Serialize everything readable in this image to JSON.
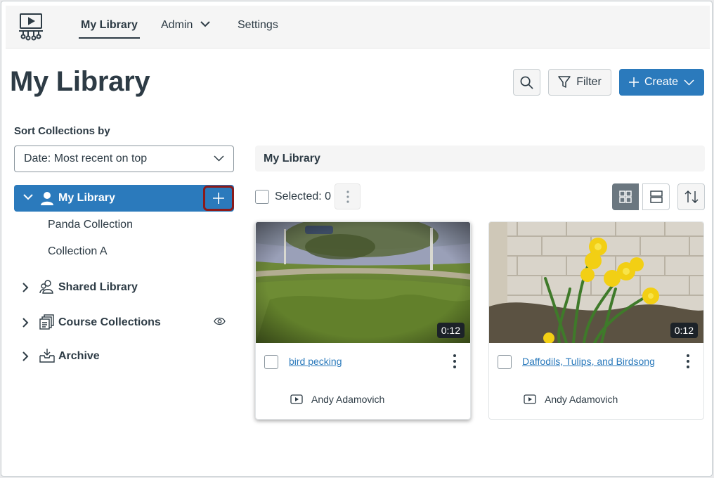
{
  "nav": {
    "items": [
      {
        "label": "My Library"
      },
      {
        "label": "Admin"
      },
      {
        "label": "Settings"
      }
    ]
  },
  "page": {
    "title": "My Library"
  },
  "toolbar": {
    "filter_label": "Filter",
    "create_label": "Create"
  },
  "sidebar": {
    "sort_label": "Sort Collections by",
    "sort_value": "Date: Most recent on top",
    "tree": {
      "my_library": "My Library",
      "sub_collections": [
        "Panda Collection",
        "Collection A"
      ],
      "shared_library": "Shared Library",
      "course_collections": "Course Collections",
      "archive": "Archive"
    }
  },
  "content": {
    "breadcrumb": "My Library",
    "selected_label": "Selected: 0",
    "cards": [
      {
        "title": "bird pecking",
        "duration": "0:12",
        "owner": "Andy Adamovich"
      },
      {
        "title": "Daffodils, Tulips, and Birdsong",
        "duration": "0:12",
        "owner": "Andy Adamovich"
      }
    ]
  },
  "colors": {
    "accent": "#2b7abc",
    "highlight_border": "#8b1a1a",
    "text": "#2d3b45"
  }
}
